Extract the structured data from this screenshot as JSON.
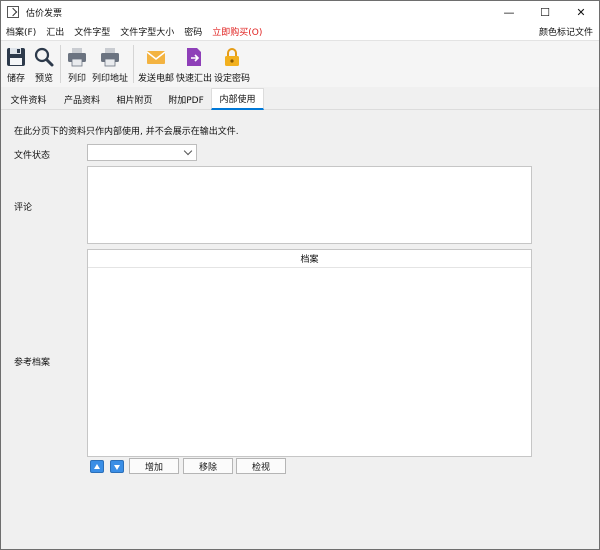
{
  "window": {
    "title": "估价发票",
    "controls": {
      "minimize": "—",
      "maximize": "☐",
      "close": "✕"
    }
  },
  "menu": {
    "items": [
      "档案(F)",
      "汇出",
      "文件字型",
      "文件字型大小",
      "密码",
      "立即购买(O)"
    ],
    "right": "颜色标记文件",
    "highlight_color": "#e0201f"
  },
  "toolbar": {
    "buttons": [
      {
        "label": "储存",
        "icon": "save-icon"
      },
      {
        "label": "预览",
        "icon": "magnifier-icon"
      },
      {
        "label": "列印",
        "icon": "printer-icon"
      },
      {
        "label": "列印地址",
        "icon": "printer-address-icon"
      },
      {
        "label": "发送电邮",
        "icon": "envelope-icon"
      },
      {
        "label": "快速汇出",
        "icon": "export-icon"
      },
      {
        "label": "设定密码",
        "icon": "padlock-icon"
      }
    ]
  },
  "tabs": {
    "items": [
      "文件资料",
      "产品资料",
      "相片附页",
      "附加PDF",
      "内部使用"
    ],
    "active_index": 4,
    "active_color": "#0078d7"
  },
  "form": {
    "notice": "在此分页下的资料只作内部使用, 并不会展示在输出文件.",
    "status_label": "文件状态",
    "status_value": "",
    "comment_label": "评论",
    "comment_value": "",
    "reference_label": "参考档案",
    "grid_header": "档案",
    "buttons": {
      "add": "增加",
      "remove": "移除",
      "view": "检视"
    }
  }
}
